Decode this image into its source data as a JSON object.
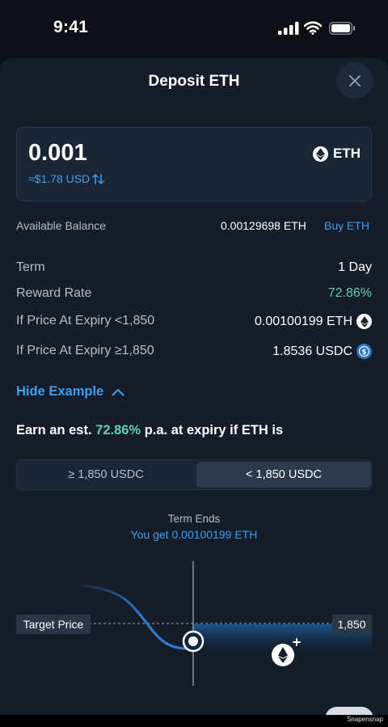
{
  "status_bar": {
    "time": "9:41"
  },
  "sheet": {
    "title": "Deposit ETH"
  },
  "amount": {
    "value": "0.001",
    "usd": "≈$1.78 USD",
    "token": "ETH"
  },
  "balance": {
    "label": "Available Balance",
    "value": "0.00129698 ETH",
    "buy_label": "Buy ETH"
  },
  "details": [
    {
      "label": "Term",
      "value": "1 Day"
    },
    {
      "label": "Reward Rate",
      "value": "72.86%"
    },
    {
      "label": "If Price At Expiry <1,850",
      "value": "0.00100199 ETH",
      "icon": "eth-icon"
    },
    {
      "label": "If Price At Expiry ≥1,850",
      "value": "1.8536 USDC",
      "icon": "usdc-icon"
    }
  ],
  "example": {
    "toggle_label": "Hide Example",
    "earn_prefix": "Earn an est.",
    "earn_rate": "72.86%",
    "earn_suffix": "p.a. at expiry if ETH is"
  },
  "segments": [
    {
      "label": "≥ 1,850 USDC",
      "selected": false
    },
    {
      "label": "< 1,850 USDC",
      "selected": true
    }
  ],
  "outcome": {
    "term_ends": "Term Ends",
    "you_get": "You get 0.00100199 ETH"
  },
  "chart_labels": {
    "target_price": "Target Price",
    "price_value": "1,850"
  },
  "colors": {
    "accent_blue": "#3d9ef0",
    "accent_green": "#5fd0b0",
    "sheet_bg": "#141d29"
  },
  "watermark": "Snapensnap"
}
